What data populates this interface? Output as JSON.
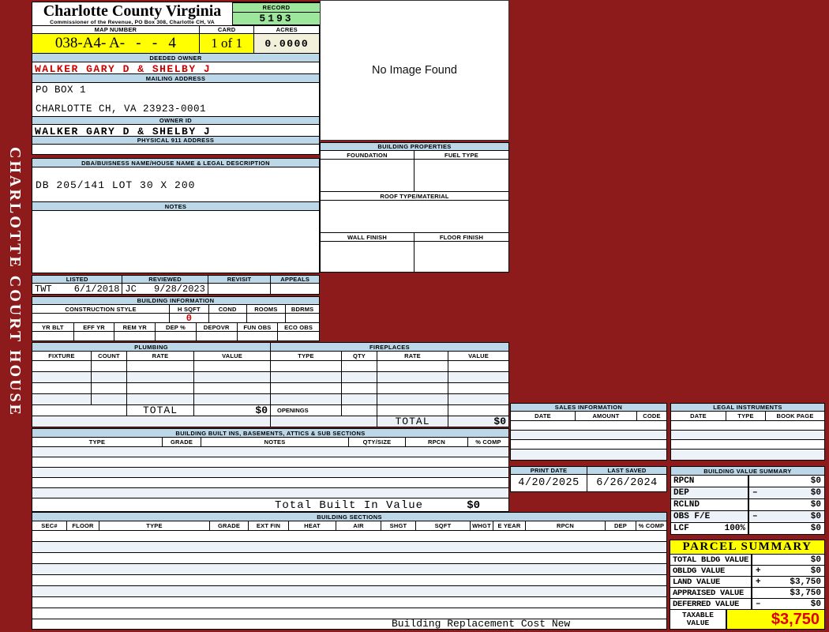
{
  "sidebar": {
    "text": "CHARLOTTE COURT HOUSE"
  },
  "colors": {
    "maroon": "#8D1B1B",
    "header_blue": "#BCD7E8",
    "highlight_yellow": "#FFFF00",
    "record_green": "#9DE79D",
    "acres_cream": "#F2EFDA",
    "alert_red": "#CC0000",
    "alt_row": "#EDF1F8"
  },
  "header": {
    "county": "Charlotte County Virginia",
    "commissioner": "Commissioner of the Revenue, PO Box 308, Charlotte CH, VA",
    "record_label": "RECORD",
    "record_value": "5193",
    "map_number_label": "MAP NUMBER",
    "map_number_value": "038-A4- A-   -   -   4",
    "card_label": "CARD",
    "card_value": "1 of 1",
    "acres_label": "ACRES",
    "acres_value": "0.0000"
  },
  "owner": {
    "deeded_owner_label": "DEEDED OWNER",
    "deeded_owner": "WALKER GARY D & SHELBY J",
    "mailing_address_label": "MAILING ADDRESS",
    "mailing_line1": "PO BOX 1",
    "mailing_line2": "CHARLOTTE CH, VA 23923-0001",
    "owner_id_label": "OWNER ID",
    "owner_id": "WALKER GARY D & SHELBY J",
    "physical_address_label": "PHYSICAL 911 ADDRESS",
    "physical_address": ""
  },
  "legal": {
    "dba_label": "DBA/BUISNESS NAME/HOUSE NAME & LEGAL DESCRIPTION",
    "description": "DB 205/141 LOT 30 X 200",
    "notes_label": "NOTES",
    "notes": ""
  },
  "visits": {
    "listed_label": "LISTED",
    "listed_by": "TWT",
    "listed_date": "6/1/2018",
    "reviewed_label": "REVIEWED",
    "reviewed_by": "JC",
    "reviewed_date": "9/28/2023",
    "revisit_label": "REVISIT",
    "appeals_label": "APPEALS"
  },
  "building_info": {
    "title": "BUILDING INFORMATION",
    "style_headers": [
      "CONSTRUCTION STYLE",
      "H SQFT",
      "COND",
      "ROOMS",
      "BDRMS"
    ],
    "h_sqft": "0",
    "year_headers": [
      "YR BLT",
      "EFF YR",
      "REM YR",
      "DEP %",
      "DEPOVR",
      "FUN OBS",
      "ECO OBS"
    ]
  },
  "image_box": {
    "text": "No Image Found"
  },
  "building_properties": {
    "title": "BUILDING PROPERTIES",
    "foundation_label": "FOUNDATION",
    "fuel_type_label": "FUEL TYPE",
    "roof_label": "ROOF TYPE/MATERIAL",
    "wall_label": "WALL FINISH",
    "floor_label": "FLOOR FINISH"
  },
  "plumbing": {
    "title": "PLUMBING",
    "headers": [
      "FIXTURE",
      "COUNT",
      "RATE",
      "VALUE"
    ],
    "total_label": "TOTAL",
    "total_value": "$0"
  },
  "fireplaces": {
    "title": "FIREPLACES",
    "headers": [
      "TYPE",
      "QTY",
      "RATE",
      "VALUE"
    ],
    "openings_label": "OPENINGS",
    "total_label": "TOTAL",
    "total_value": "$0"
  },
  "built_ins": {
    "title": "BUILDING BUILT INS, BASEMENTS, ATTICS & SUB SECTIONS",
    "headers": [
      "TYPE",
      "GRADE",
      "NOTES",
      "QTY/SIZE",
      "RPCN",
      "% COMP"
    ],
    "total_label": "Total Built In Value",
    "total_value": "$0"
  },
  "building_sections": {
    "title": "BUILDING SECTIONS",
    "headers": [
      "SEC#",
      "FLOOR",
      "TYPE",
      "GRADE",
      "EXT FIN",
      "HEAT",
      "AIR",
      "SHGT",
      "SQFT",
      "WHGT",
      "E YEAR",
      "RPCN",
      "DEP",
      "% COMP"
    ],
    "footer": "Building Replacement Cost New"
  },
  "sales": {
    "title": "SALES INFORMATION",
    "headers": [
      "DATE",
      "AMOUNT",
      "CODE"
    ]
  },
  "legal_instruments": {
    "title": "LEGAL INSTRUMENTS",
    "headers": [
      "DATE",
      "TYPE",
      "BOOK PAGE"
    ]
  },
  "dates": {
    "print_date_label": "PRINT DATE",
    "print_date": "4/20/2025",
    "last_saved_label": "LAST SAVED",
    "last_saved": "6/26/2024"
  },
  "building_value_summary": {
    "title": "BUILDING VALUE SUMMARY",
    "rows": [
      {
        "label": "RPCN",
        "pct": "",
        "op": "",
        "value": "$0"
      },
      {
        "label": "DEP",
        "pct": "",
        "op": "–",
        "value": "$0"
      },
      {
        "label": "RCLND",
        "pct": "",
        "op": "",
        "value": "$0"
      },
      {
        "label": "OBS F/E",
        "pct": "",
        "op": "–",
        "value": "$0"
      },
      {
        "label": "LCF",
        "pct": "100%",
        "op": "",
        "value": "$0"
      }
    ]
  },
  "parcel_summary": {
    "title": "PARCEL SUMMARY",
    "rows": [
      {
        "label": "TOTAL BLDG VALUE",
        "op": "",
        "value": "$0"
      },
      {
        "label": "OBLDG VALUE",
        "op": "+",
        "value": "$0"
      },
      {
        "label": "LAND VALUE",
        "op": "+",
        "value": "$3,750"
      },
      {
        "label": "APPRAISED VALUE",
        "op": "",
        "value": "$3,750"
      },
      {
        "label": "DEFERRED VALUE",
        "op": "–",
        "value": "$0"
      }
    ],
    "taxable_label": "TAXABLE VALUE",
    "taxable_value": "$3,750"
  }
}
